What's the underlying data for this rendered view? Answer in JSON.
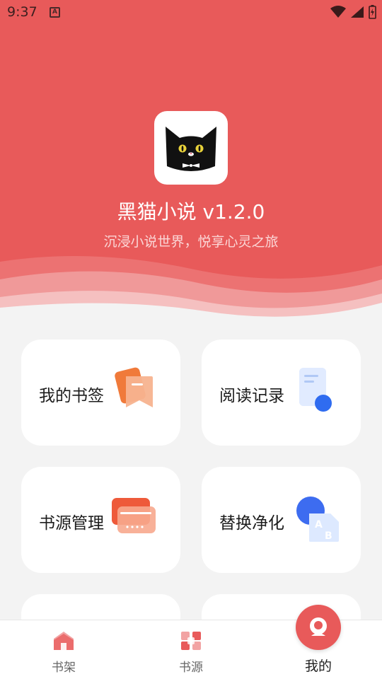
{
  "status_bar": {
    "time": "9:37",
    "notification_icon": "A",
    "icons": [
      "wifi-icon",
      "signal-icon",
      "battery-charging-icon"
    ]
  },
  "header": {
    "app_name": "黑猫小说 v1.2.0",
    "slogan": "沉浸小说世界，悦享心灵之旅",
    "background_color": "#e85a5a"
  },
  "cards": [
    {
      "label": "我的书签",
      "icon": "bookmark-icon"
    },
    {
      "label": "阅读记录",
      "icon": "reading-history-icon"
    },
    {
      "label": "书源管理",
      "icon": "source-management-icon"
    },
    {
      "label": "替换净化",
      "icon": "replace-purify-icon"
    }
  ],
  "bottom_nav": [
    {
      "label": "书架",
      "icon": "bookshelf-icon",
      "active": false
    },
    {
      "label": "书源",
      "icon": "sources-icon",
      "active": false
    },
    {
      "label": "我的",
      "icon": "profile-icon",
      "active": true
    }
  ],
  "colors": {
    "accent": "#e85a5a",
    "background": "#f3f3f3",
    "card": "#ffffff"
  }
}
